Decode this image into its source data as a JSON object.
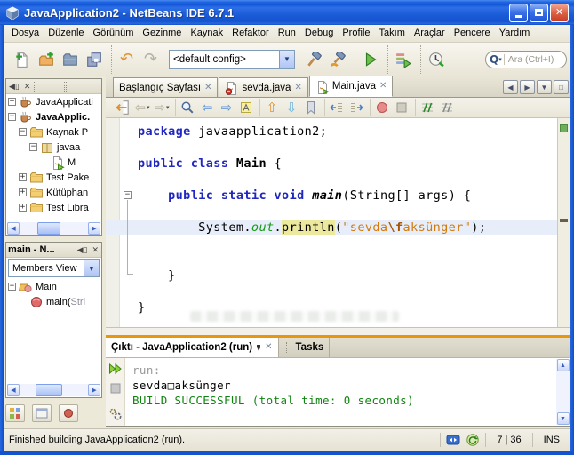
{
  "window": {
    "title": "JavaApplication2 - NetBeans IDE 6.7.1"
  },
  "menu": {
    "items": [
      "Dosya",
      "Düzenle",
      "Görünüm",
      "Gezinme",
      "Kaynak",
      "Refaktor",
      "Run",
      "Debug",
      "Profile",
      "Takım",
      "Araçlar",
      "Pencere",
      "Yardım"
    ]
  },
  "toolbar": {
    "config_combo_value": "<default config>",
    "search_placeholder": "Ara (Ctrl+I)",
    "groups": [
      [
        "new-file",
        "new-project",
        "open-project",
        "save-all"
      ],
      [
        "undo",
        "redo"
      ]
    ],
    "groups_after_combo": [
      [
        "build",
        "clean-build"
      ],
      [
        "run"
      ],
      [
        "debug"
      ],
      [
        "profile"
      ]
    ]
  },
  "editor_toolbar": {
    "groups": [
      [
        "last-edit",
        "back",
        "forward"
      ],
      [
        "find",
        "find-prev",
        "find-next",
        "highlight"
      ],
      [
        "bm-prev",
        "bm-next",
        "bm-toggle"
      ],
      [
        "shift-left",
        "shift-right"
      ],
      [
        "record-macro",
        "stop-macro"
      ],
      [
        "comment",
        "uncomment"
      ]
    ]
  },
  "projects_panel": {
    "items": [
      {
        "label": "JavaApplicati",
        "icon": "project-coffee",
        "expand": "+",
        "indent": 0,
        "bold": false
      },
      {
        "label": "JavaApplic.",
        "icon": "project-coffee",
        "expand": "-",
        "indent": 0,
        "bold": true
      },
      {
        "label": "Kaynak P",
        "icon": "folder",
        "expand": "-",
        "indent": 1,
        "bold": false
      },
      {
        "label": "javaa",
        "icon": "package",
        "expand": "-",
        "indent": 2,
        "bold": false
      },
      {
        "label": "M",
        "icon": "java-main-file",
        "expand": null,
        "indent": 3,
        "bold": false
      },
      {
        "label": "Test Pake",
        "icon": "folder",
        "expand": "+",
        "indent": 1,
        "bold": false
      },
      {
        "label": "Kütüphan",
        "icon": "folder",
        "expand": "+",
        "indent": 1,
        "bold": false
      },
      {
        "label": "Test Libra",
        "icon": "folder",
        "expand": "+",
        "indent": 1,
        "bold": false
      }
    ]
  },
  "navigator_panel": {
    "title": "main - N...",
    "combo_value": "Members View",
    "items": [
      {
        "label": "Main",
        "icon": "class",
        "expand": "-",
        "indent": 0,
        "bold": false
      },
      {
        "label": "main(",
        "secondary": "Stri",
        "icon": "method",
        "expand": null,
        "indent": 1,
        "bold": false
      }
    ]
  },
  "editor": {
    "tabs": [
      {
        "label": "Başlangıç Sayfası",
        "icon": null,
        "active": false
      },
      {
        "label": "sevda.java",
        "icon": "java-error-file",
        "active": false
      },
      {
        "label": "Main.java",
        "icon": "java-main-file",
        "active": true
      }
    ],
    "current_line": 6,
    "code": [
      [
        {
          "t": "package",
          "s": "kw"
        },
        {
          "t": " javaapplication2;",
          "s": "pl"
        }
      ],
      [],
      [
        {
          "t": "public",
          "s": "kw"
        },
        {
          "t": " ",
          "s": "pl"
        },
        {
          "t": "class",
          "s": "kw"
        },
        {
          "t": " ",
          "s": "pl"
        },
        {
          "t": "Main",
          "s": "cls"
        },
        {
          "t": " {",
          "s": "pl"
        }
      ],
      [],
      [
        {
          "t": "    ",
          "s": "pl"
        },
        {
          "t": "public",
          "s": "kw"
        },
        {
          "t": " ",
          "s": "pl"
        },
        {
          "t": "static",
          "s": "kw"
        },
        {
          "t": " ",
          "s": "pl"
        },
        {
          "t": "void",
          "s": "kw"
        },
        {
          "t": " ",
          "s": "pl"
        },
        {
          "t": "main",
          "s": "mth"
        },
        {
          "t": "(String[] args) {",
          "s": "pl"
        }
      ],
      [],
      [
        {
          "t": "        System.",
          "s": "pl"
        },
        {
          "t": "out",
          "s": "fld"
        },
        {
          "t": ".",
          "s": "pl"
        },
        {
          "t": "println",
          "s": "occ"
        },
        {
          "t": "(",
          "s": "pl"
        },
        {
          "t": "\"sevda",
          "s": "str"
        },
        {
          "t": "\\f",
          "s": "esc"
        },
        {
          "t": "aksünger\"",
          "s": "str"
        },
        {
          "t": ");",
          "s": "pl"
        }
      ],
      [],
      [],
      [
        {
          "t": "    }",
          "s": "pl"
        }
      ],
      [],
      [
        {
          "t": "}",
          "s": "pl"
        }
      ]
    ]
  },
  "output_panel": {
    "tab_label": "Çıktı - JavaApplication2 (run)",
    "tasks_tab_label": "Tasks",
    "lines": [
      {
        "text": "run:",
        "style": "muted"
      },
      {
        "text": "sevda□aksünger",
        "style": "plain"
      },
      {
        "text": "BUILD SUCCESSFUL (total time: 0 seconds)",
        "style": "success"
      }
    ]
  },
  "status_bar": {
    "message": "Finished building JavaApplication2 (run).",
    "caret_position": "7 | 36",
    "insert_mode": "INS"
  },
  "icons": {
    "netbeans-cube": "3d cube logo",
    "minimize": "white bar",
    "maximize": "white box",
    "close": "white x on red",
    "new-file": "page with green plus",
    "new-project": "orange folder with green plus",
    "open-project": "blue folder",
    "save-all": "stacked disks",
    "undo": "orange curved arrow left",
    "redo": "gray curved arrow right",
    "build": "hammer",
    "clean-build": "hammer with orange broom",
    "run": "green play triangle",
    "debug": "list with green play",
    "profile": "clock with green arrow",
    "search-magnifier": "magnifying glass",
    "last-edit": "page with orange back arrow",
    "back": "gray left arrow",
    "forward": "gray right arrow",
    "find": "magnifier",
    "find-prev": "blue left arrow",
    "find-next": "blue right arrow",
    "highlight": "yellow highlight block",
    "bm-prev": "orange up arrow",
    "bm-next": "cyan down arrow",
    "bm-toggle": "gray bookmark ribbon",
    "shift-left": "indent left",
    "shift-right": "indent right",
    "record-macro": "red circle",
    "stop-macro": "gray square",
    "comment": "green slashes over lines",
    "uncomment": "gray slashes over lines",
    "project-coffee": "coffee cup",
    "folder": "yellow folder",
    "package": "tan package box",
    "java-main-file": "java file with green arrow",
    "java-error-file": "java file with red error badge",
    "class": "orange class shape with pink circle",
    "method": "red-pink circle",
    "rerun": "double green play",
    "stop": "gray stop square",
    "ant-settings": "double gear",
    "status-sync": "blue box with white arrows",
    "status-update": "green circular arrow",
    "panel-minimize": "collapse arrow",
    "panel-close": "x",
    "chevron-down": "dropdown triangle with bar"
  }
}
